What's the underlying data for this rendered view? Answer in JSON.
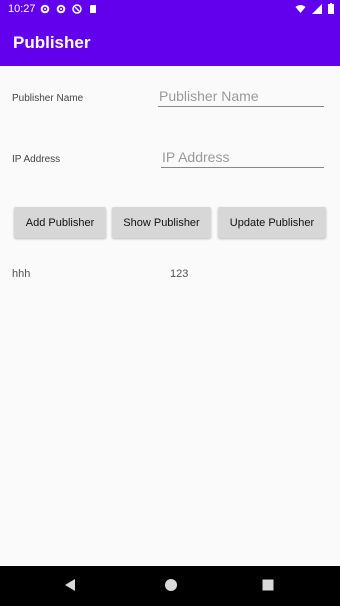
{
  "status_bar": {
    "time": "10:27",
    "bg_color": "#6200ee",
    "left_icons": [
      "gear-icon",
      "gear-icon",
      "circle-icon",
      "sd-card-icon"
    ],
    "right_icons": [
      "wifi-icon",
      "signal-icon",
      "battery-icon"
    ]
  },
  "app_bar": {
    "title": "Publisher",
    "bg_color": "#6200ee"
  },
  "form": {
    "publisher_name": {
      "label": "Publisher Name",
      "placeholder": "Publisher Name",
      "value": ""
    },
    "ip_address": {
      "label": "IP Address",
      "placeholder": "IP Address",
      "value": ""
    }
  },
  "buttons": {
    "add": "Add Publisher",
    "show": "Show Publisher",
    "update": "Update Publisher"
  },
  "list": {
    "rows": [
      {
        "name": "hhh",
        "ip": "123"
      }
    ]
  },
  "nav_bar": {
    "icons": [
      "back-icon",
      "home-icon",
      "recents-icon"
    ]
  }
}
